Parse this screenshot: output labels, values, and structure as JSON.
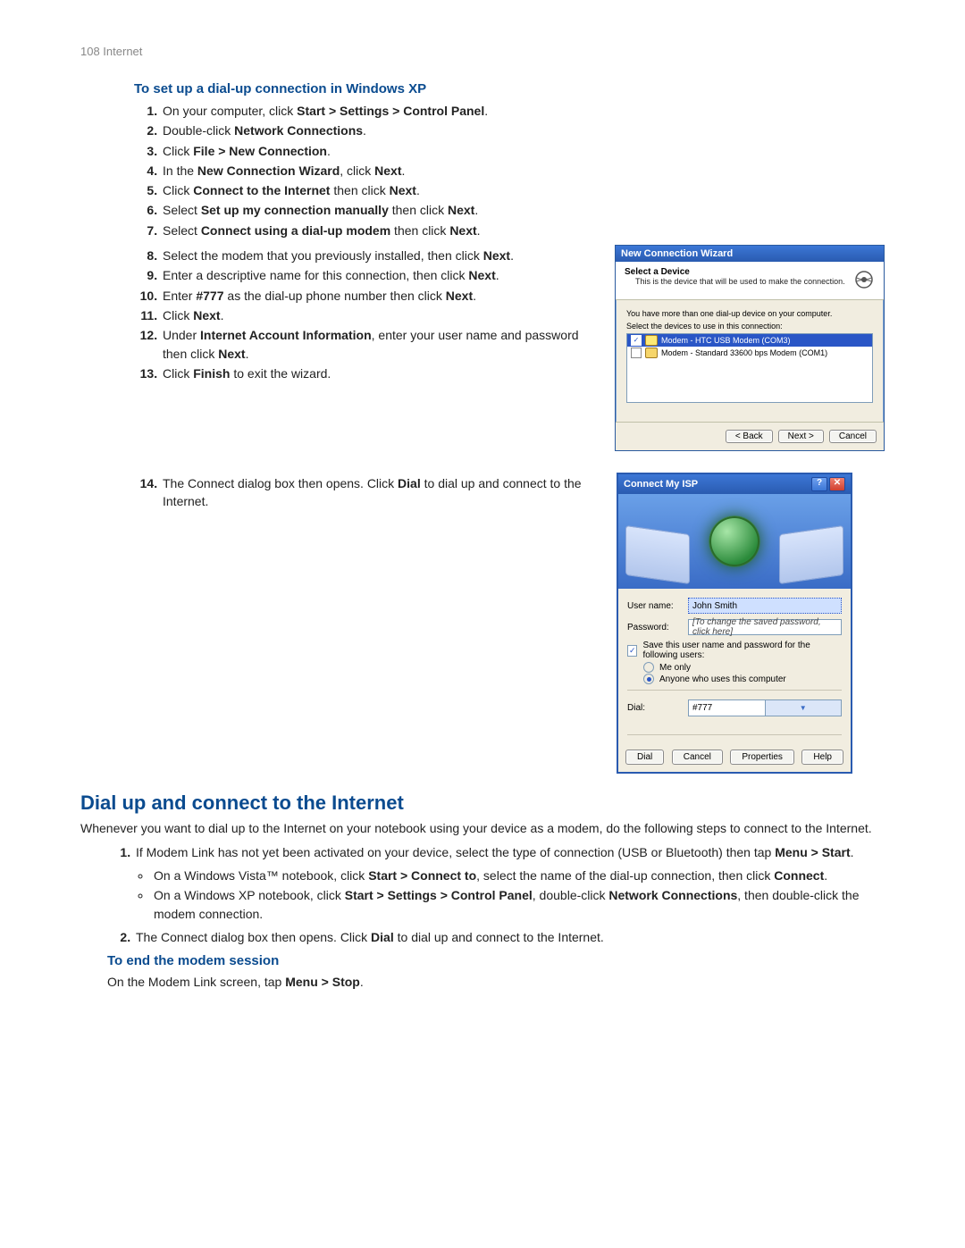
{
  "page_header": "108  Internet",
  "section1": {
    "title": "To set up a dial-up connection in Windows XP",
    "steps_a": [
      {
        "pre": "On your computer, click ",
        "bold": "Start > Settings > Control Panel",
        "post": "."
      },
      {
        "pre": "Double-click ",
        "bold": "Network Connections",
        "post": "."
      },
      {
        "pre": "Click ",
        "bold": "File > New Connection",
        "post": "."
      },
      {
        "pre": "In the ",
        "bold": "New Connection Wizard",
        "post": ", click ",
        "bold2": "Next",
        "post2": "."
      },
      {
        "pre": "Click ",
        "bold": "Connect to the Internet",
        "post": " then click ",
        "bold2": "Next",
        "post2": "."
      },
      {
        "pre": "Select ",
        "bold": "Set up my connection manually",
        "post": " then click ",
        "bold2": "Next",
        "post2": "."
      },
      {
        "pre": "Select ",
        "bold": "Connect using a dial-up modem",
        "post": " then click ",
        "bold2": "Next",
        "post2": "."
      }
    ],
    "steps_b": [
      {
        "text_pre": "Select the modem that you previously installed, then click ",
        "bold": "Next",
        "text_post": "."
      },
      {
        "text_pre": "Enter a descriptive name for this connection, then click ",
        "bold": "Next",
        "text_post": "."
      },
      {
        "text_pre": "Enter ",
        "bold": "#777",
        "text_mid": " as the dial-up phone number then click ",
        "bold2": "Next",
        "text_post": "."
      },
      {
        "text_pre": "Click ",
        "bold": "Next",
        "text_post": "."
      },
      {
        "text_pre": "Under ",
        "bold": "Internet Account Information",
        "text_mid": ", enter your user name and password then click ",
        "bold2": "Next",
        "text_post": "."
      },
      {
        "text_pre": "Click ",
        "bold": "Finish",
        "text_post": " to exit the wizard."
      }
    ],
    "step14": {
      "text_pre": "The Connect dialog box then opens. Click ",
      "bold": "Dial",
      "text_post": " to dial up and connect to the Internet."
    }
  },
  "wizard": {
    "title": "New Connection Wizard",
    "header_title": "Select a Device",
    "header_sub": "This is the device that will be used to make the connection.",
    "panel_line1": "You have more than one dial-up device on your computer.",
    "panel_line2": "Select the devices to use in this connection:",
    "devices": [
      {
        "checked": true,
        "selected": true,
        "label": "Modem - HTC USB Modem (COM3)"
      },
      {
        "checked": false,
        "selected": false,
        "label": "Modem - Standard 33600 bps Modem (COM1)"
      }
    ],
    "btn_back": "< Back",
    "btn_next": "Next >",
    "btn_cancel": "Cancel"
  },
  "isp": {
    "title": "Connect My ISP",
    "lbl_user": "User name:",
    "val_user": "John Smith",
    "lbl_pass": "Password:",
    "val_pass": "[To change the saved password, click here]",
    "chk_save": "Save this user name and password for the following users:",
    "radio_me": "Me only",
    "radio_any": "Anyone who uses this computer",
    "lbl_dial": "Dial:",
    "val_dial": "#777",
    "btn_dial": "Dial",
    "btn_cancel": "Cancel",
    "btn_props": "Properties",
    "btn_help": "Help"
  },
  "section2": {
    "title": "Dial up and connect to the Internet",
    "intro": "Whenever you want to dial up to the Internet on your notebook using your device as a modem, do the following steps to connect to the Internet.",
    "step1": {
      "pre": "If Modem Link has not yet been activated on your device, select the type of connection (USB or Bluetooth) then  tap ",
      "bold": "Menu > Start",
      "post": "."
    },
    "bullet1": {
      "pre": "On a Windows Vista™ notebook, click ",
      "bold1": "Start > Connect to",
      "mid": ", select the name of the dial-up connection, then  click ",
      "bold2": "Connect",
      "post": "."
    },
    "bullet2": {
      "pre": "On a Windows XP notebook, click ",
      "bold1": "Start > Settings > Control Panel",
      "mid": ", double-click ",
      "bold2": "Network Connections",
      "post": ", then double-click the modem connection."
    },
    "step2": {
      "pre": "The Connect dialog box then opens. Click ",
      "bold": "Dial",
      "post": " to dial up and connect to the Internet."
    }
  },
  "section3": {
    "title": "To end the modem session",
    "body": {
      "pre": "On the Modem Link screen,  tap ",
      "bold": "Menu > Stop",
      "post": "."
    }
  }
}
